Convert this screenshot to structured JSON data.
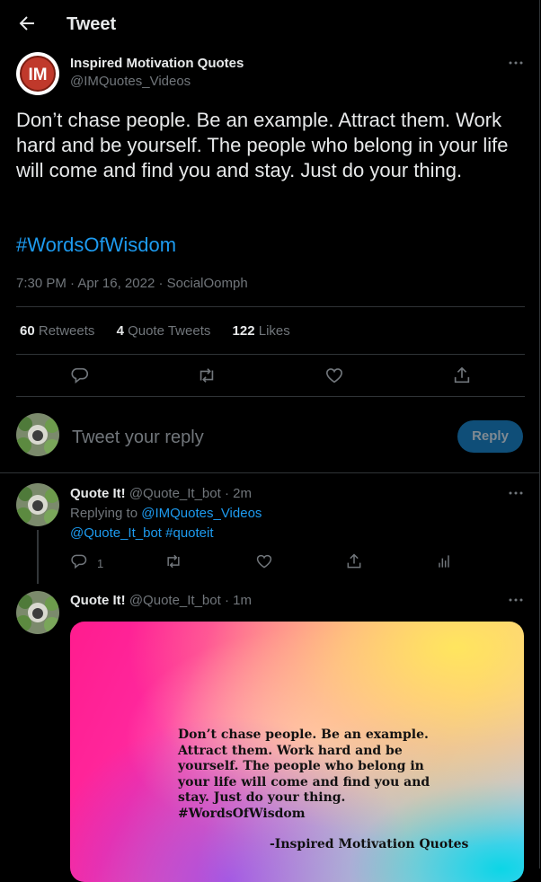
{
  "header": {
    "title": "Tweet",
    "back_icon": "arrow-left-icon"
  },
  "tweet": {
    "author_name": "Inspired Motivation Quotes",
    "author_handle": "@IMQuotes_Videos",
    "avatar_initials": "IM",
    "text": "Don’t chase people. Be an example. Attract them. Work hard and be yourself. The people who belong in your life will come and find you and stay. Just do your thing.",
    "hashtag": "#WordsOfWisdom",
    "time": "7:30 PM",
    "date": "Apr 16, 2022",
    "source": "SocialOomph",
    "retweets_count": "60",
    "retweets_label": "Retweets",
    "quote_count": "4",
    "quote_label": "Quote Tweets",
    "likes_count": "122",
    "likes_label": "Likes"
  },
  "composer": {
    "placeholder": "Tweet your reply",
    "reply_label": "Reply"
  },
  "replies": [
    {
      "name": "Quote It!",
      "handle": "@Quote_It_bot",
      "age": "2m",
      "replying_to_label": "Replying to",
      "replying_to_handle": "@IMQuotes_Videos",
      "text_mention": "@Quote_It_bot",
      "text_hashtag": "#quoteit",
      "reply_count": "1"
    },
    {
      "name": "Quote It!",
      "handle": "@Quote_It_bot",
      "age": "1m",
      "media": {
        "quote": "Don’t chase people. Be an example. Attract them. Work hard and be yourself. The people who belong in your life will come and find you and stay. Just do your thing. #WordsOfWisdom",
        "author": "-Inspired Motivation Quotes"
      }
    }
  ],
  "colors": {
    "accent": "#1d9bf0",
    "background": "#000000",
    "muted": "#71767b",
    "divider": "#2f3336"
  }
}
